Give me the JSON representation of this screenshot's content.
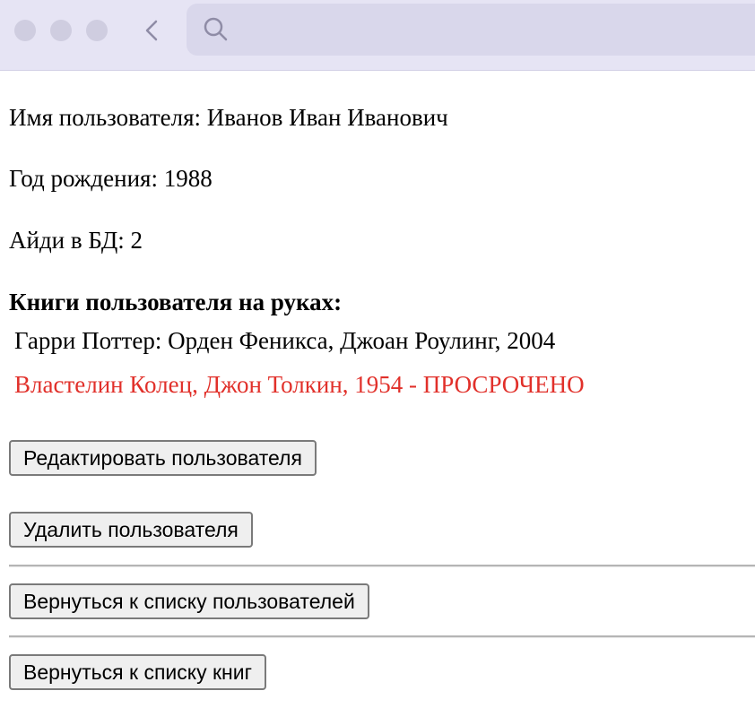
{
  "user": {
    "name_line": "Имя пользователя: Иванов Иван Иванович",
    "birth_line": "Год рождения: 1988",
    "id_line": "Айди в БД: 2"
  },
  "books": {
    "heading": "Книги пользователя на руках:",
    "items": [
      {
        "text": "Гарри Поттер: Орден Феникса, Джоан Роулинг, 2004",
        "overdue": false
      },
      {
        "text": "Властелин Колец, Джон Толкин, 1954 - ПРОСРОЧЕНО",
        "overdue": true
      }
    ]
  },
  "actions": {
    "edit_label": "Редактировать пользователя",
    "delete_label": "Удалить пользователя",
    "back_users_label": "Вернуться к списку пользователей",
    "back_books_label": "Вернуться к списку книг"
  },
  "colors": {
    "overdue": "#e1302a"
  },
  "icons": {
    "back": "chevron-left-icon",
    "search": "search-icon"
  }
}
